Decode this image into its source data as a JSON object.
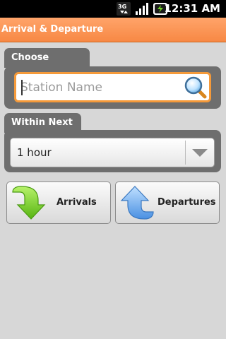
{
  "status_bar": {
    "network_type": "3G",
    "time": "12:31 AM"
  },
  "app_title": "Arrival & Departure",
  "station": {
    "section_label": "Choose Station",
    "placeholder": "Station Name",
    "value": ""
  },
  "within": {
    "section_label": "Within Next",
    "selected": "1 hour"
  },
  "actions": {
    "arrivals_label": "Arrivals",
    "departures_label": "Departures"
  },
  "colors": {
    "accent": "#f78844",
    "focus_border": "#f59a3a",
    "arrivals_icon": "#7ad21d",
    "departures_icon": "#4a90e2"
  }
}
